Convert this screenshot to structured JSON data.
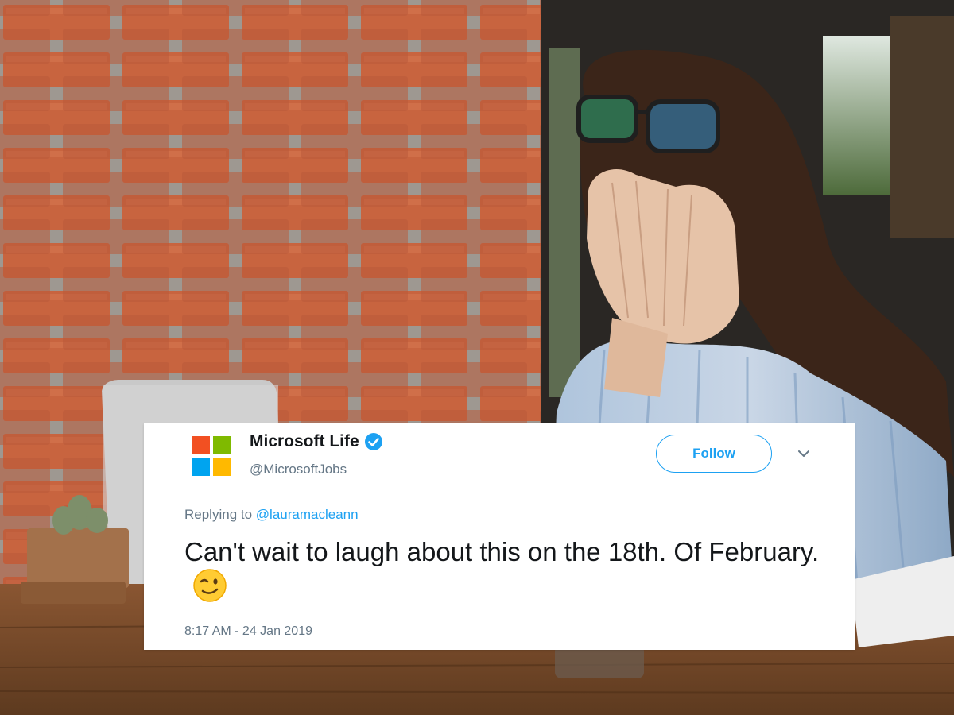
{
  "tweet": {
    "display_name": "Microsoft Life",
    "handle": "@MicrosoftJobs",
    "follow_label": "Follow",
    "replying_prefix": "Replying to",
    "replying_to": "@lauramacleann",
    "text": "Can't wait to laugh about this on the 18th. Of February.",
    "emoji": "winking-face",
    "timestamp": "8:17 AM - 24 Jan 2019"
  },
  "icons": {
    "logo": "microsoft-logo-icon",
    "verified": "verified-badge-icon",
    "menu": "chevron-down-icon"
  },
  "colors": {
    "twitter_blue": "#1da1f2",
    "text_primary": "#14171a",
    "text_secondary": "#657786",
    "ms_red": "#f25022",
    "ms_green": "#7fba00",
    "ms_blue": "#00a4ef",
    "ms_yellow": "#ffb900"
  }
}
